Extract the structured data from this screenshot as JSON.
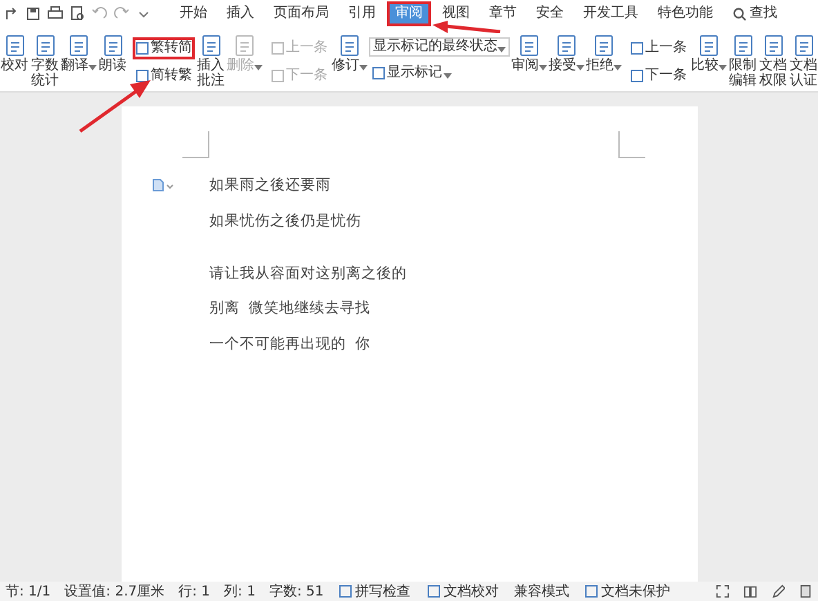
{
  "menu_tabs": [
    {
      "label": "开始",
      "selected": false,
      "highlighted": false
    },
    {
      "label": "插入",
      "selected": false,
      "highlighted": false
    },
    {
      "label": "页面布局",
      "selected": false,
      "highlighted": false
    },
    {
      "label": "引用",
      "selected": false,
      "highlighted": false
    },
    {
      "label": "审阅",
      "selected": true,
      "highlighted": true
    },
    {
      "label": "视图",
      "selected": false,
      "highlighted": false
    },
    {
      "label": "章节",
      "selected": false,
      "highlighted": false
    },
    {
      "label": "安全",
      "selected": false,
      "highlighted": false
    },
    {
      "label": "开发工具",
      "selected": false,
      "highlighted": false
    },
    {
      "label": "特色功能",
      "selected": false,
      "highlighted": false
    }
  ],
  "search": {
    "label": "查找"
  },
  "ribbon": [
    {
      "kind": "large",
      "label": "校对",
      "caret": false,
      "disabled": false
    },
    {
      "kind": "large",
      "label": "字数统计",
      "caret": false,
      "disabled": false
    },
    {
      "kind": "large",
      "label": "翻译",
      "caret": true,
      "disabled": false
    },
    {
      "kind": "large",
      "label": "朗读",
      "caret": false,
      "disabled": false
    },
    {
      "kind": "stack",
      "items": [
        {
          "label": "繁转简",
          "disabled": false,
          "highlighted": true
        },
        {
          "label": "简转繁",
          "disabled": false,
          "highlighted": false
        }
      ]
    },
    {
      "kind": "large",
      "label": "插入批注",
      "caret": false,
      "disabled": false
    },
    {
      "kind": "large",
      "label": "删除",
      "caret": true,
      "disabled": true
    },
    {
      "kind": "stack",
      "items": [
        {
          "label": "上一条",
          "disabled": true,
          "highlighted": false
        },
        {
          "label": "下一条",
          "disabled": true,
          "highlighted": false
        }
      ]
    },
    {
      "kind": "large",
      "label": "修订",
      "caret": true,
      "disabled": false
    },
    {
      "kind": "dropdown",
      "value": "显示标记的最终状态",
      "label": "显示标记"
    },
    {
      "kind": "large",
      "label": "审阅",
      "caret": true,
      "disabled": false
    },
    {
      "kind": "large",
      "label": "接受",
      "caret": true,
      "disabled": false
    },
    {
      "kind": "large",
      "label": "拒绝",
      "caret": true,
      "disabled": false
    },
    {
      "kind": "stack",
      "items": [
        {
          "label": "上一条",
          "disabled": false,
          "highlighted": false
        },
        {
          "label": "下一条",
          "disabled": false,
          "highlighted": false
        }
      ]
    },
    {
      "kind": "large",
      "label": "比较",
      "caret": true,
      "disabled": false
    },
    {
      "kind": "large",
      "label": "限制编辑",
      "caret": false,
      "disabled": false
    },
    {
      "kind": "large",
      "label": "文档权限",
      "caret": false,
      "disabled": false
    },
    {
      "kind": "large",
      "label": "文档认证",
      "caret": false,
      "disabled": false
    }
  ],
  "document": {
    "paragraphs": [
      {
        "lines": [
          "如果雨之後还要雨",
          "如果忧伤之後仍是忧伤"
        ]
      },
      {
        "lines": [
          "请让我从容面对这别离之後的",
          "别离  微笑地继续去寻找",
          "一个不可能再出现的  你"
        ]
      }
    ]
  },
  "status_bar": {
    "items": [
      {
        "kind": "text",
        "label": "节: 1/1"
      },
      {
        "kind": "text",
        "label": "设置值: 2.7厘米"
      },
      {
        "kind": "text",
        "label": "行: 1"
      },
      {
        "kind": "text",
        "label": "列: 1"
      },
      {
        "kind": "text",
        "label": "字数: 51"
      },
      {
        "kind": "button",
        "label": "拼写检查"
      },
      {
        "kind": "button",
        "label": "文档校对"
      },
      {
        "kind": "text",
        "label": "兼容模式"
      },
      {
        "kind": "button",
        "label": "文档未保护"
      }
    ]
  }
}
